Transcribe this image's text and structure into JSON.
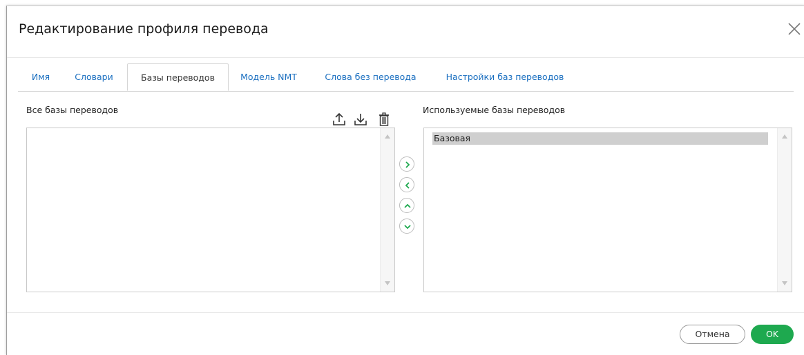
{
  "dialog": {
    "title": "Редактирование профиля перевода"
  },
  "tabs": [
    {
      "label": "Имя"
    },
    {
      "label": "Словари"
    },
    {
      "label": "Базы переводов"
    },
    {
      "label": "Модель NMT"
    },
    {
      "label": "Слова без перевода"
    },
    {
      "label": "Настройки баз переводов"
    }
  ],
  "active_tab": "Базы переводов",
  "left_panel": {
    "label": "Все базы переводов",
    "items": []
  },
  "right_panel": {
    "label": "Используемые базы переводов",
    "items": [
      "Базовая"
    ],
    "selected": "Базовая"
  },
  "toolbar_icons": [
    "upload-icon",
    "download-icon",
    "trash-icon"
  ],
  "move_buttons": [
    "move-right",
    "move-left",
    "move-up",
    "move-down"
  ],
  "footer": {
    "cancel_label": "Отмена",
    "ok_label": "OK"
  },
  "colors": {
    "link": "#1a6fc0",
    "ok_button": "#1ea94f",
    "selected_item": "#cfcfcf",
    "move_button_icon": "#1ea94f"
  }
}
